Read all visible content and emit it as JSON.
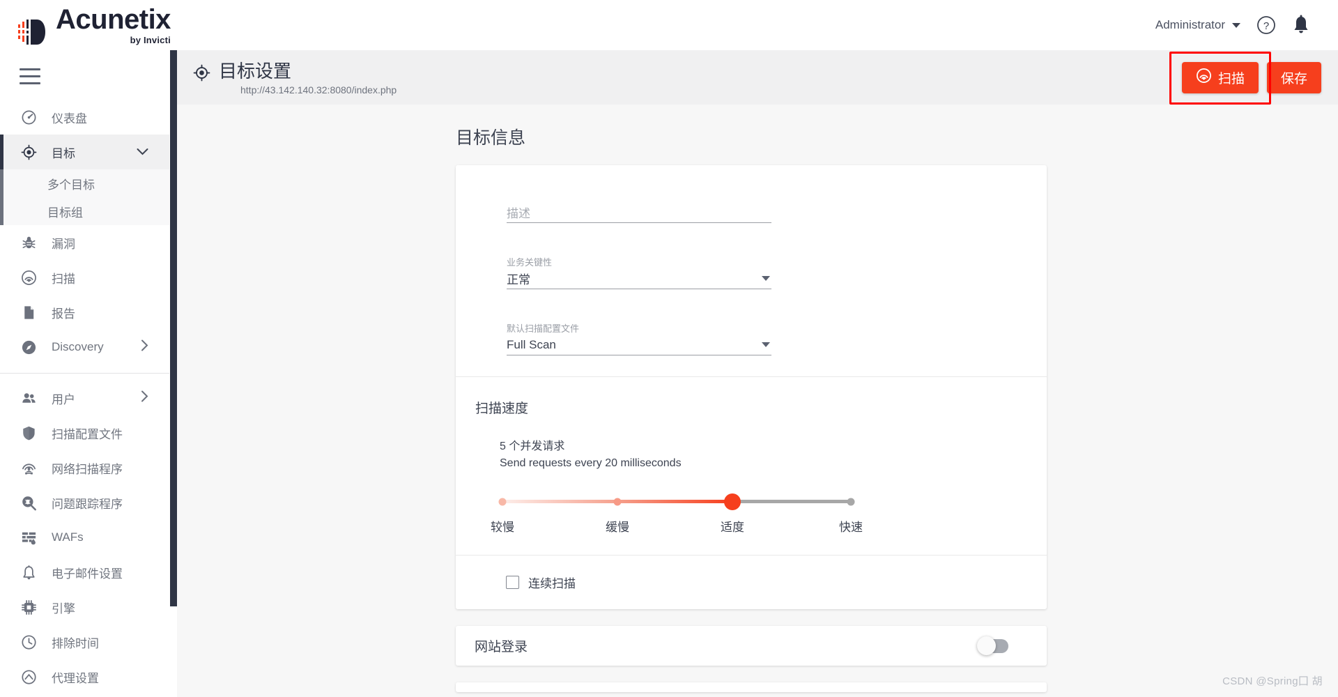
{
  "brand": {
    "name": "Acunetix",
    "sub": "by Invicti",
    "logo_icon": "acunetix-logo-icon"
  },
  "topbar": {
    "admin_label": "Administrator",
    "caret_icon": "chevron-down-icon",
    "help_icon": "help-circle-icon",
    "notification_icon": "bell-icon"
  },
  "sidebar": {
    "menu_icon": "hamburger-menu-icon",
    "items": [
      {
        "label": "仪表盘",
        "icon": "dashboard-gauge-icon",
        "active": false,
        "expandable": false
      },
      {
        "label": "目标",
        "icon": "target-crosshair-icon",
        "active": true,
        "expandable": true,
        "chevron": "chevron-down-icon"
      },
      {
        "label": "漏洞",
        "icon": "bug-icon",
        "active": false,
        "expandable": false
      },
      {
        "label": "扫描",
        "icon": "scan-radar-icon",
        "active": false,
        "expandable": false
      },
      {
        "label": "报告",
        "icon": "document-icon",
        "active": false,
        "expandable": false
      },
      {
        "label": "Discovery",
        "icon": "compass-icon",
        "active": false,
        "expandable": true,
        "chevron": "chevron-right-icon"
      },
      {
        "label": "用户",
        "icon": "users-icon",
        "active": false,
        "expandable": true,
        "chevron": "chevron-right-icon"
      },
      {
        "label": "扫描配置文件",
        "icon": "shield-icon",
        "active": false,
        "expandable": false
      },
      {
        "label": "网络扫描程序",
        "icon": "network-scanner-icon",
        "active": false,
        "expandable": false
      },
      {
        "label": "问题跟踪程序",
        "icon": "issue-tracker-icon",
        "active": false,
        "expandable": false
      },
      {
        "label": "WAFs",
        "icon": "firewall-icon",
        "active": false,
        "expandable": false
      },
      {
        "label": "电子邮件设置",
        "icon": "bell-icon",
        "active": false,
        "expandable": false
      },
      {
        "label": "引擎",
        "icon": "engine-chip-icon",
        "active": false,
        "expandable": false
      },
      {
        "label": "排除时间",
        "icon": "clock-icon",
        "active": false,
        "expandable": false
      },
      {
        "label": "代理设置",
        "icon": "proxy-icon",
        "active": false,
        "expandable": false
      }
    ],
    "subitems": [
      {
        "label": "多个目标"
      },
      {
        "label": "目标组"
      }
    ]
  },
  "page_header": {
    "icon": "target-crosshair-icon",
    "title": "目标设置",
    "url": "http://43.142.140.32:8080/index.php",
    "scan_button": "扫描",
    "scan_icon": "scan-radar-icon",
    "save_button": "保存"
  },
  "main": {
    "section_title": "目标信息",
    "description_field": {
      "label": "",
      "placeholder": "描述",
      "value": ""
    },
    "business_criticality": {
      "label": "业务关键性",
      "value": "正常",
      "caret_icon": "chevron-down-icon"
    },
    "default_scan_profile": {
      "label": "默认扫描配置文件",
      "value": "Full Scan",
      "caret_icon": "chevron-down-icon"
    },
    "scan_speed": {
      "heading": "扫描速度",
      "concurrent_line": "5 个并发请求",
      "interval_line": "Send requests every 20 milliseconds",
      "ticks": [
        "较慢",
        "缓慢",
        "适度",
        "快速"
      ],
      "selected_index": 2
    },
    "continuous_scan": {
      "label": "连续扫描",
      "checked": false
    },
    "site_login": {
      "title": "网站登录",
      "enabled": false
    }
  },
  "colors": {
    "accent": "#f63f1d",
    "sidebar_active_bar": "#2f3545",
    "annotation": "#ff0000",
    "text": "#3d4351"
  },
  "watermark": "CSDN @Spring囗 胡"
}
